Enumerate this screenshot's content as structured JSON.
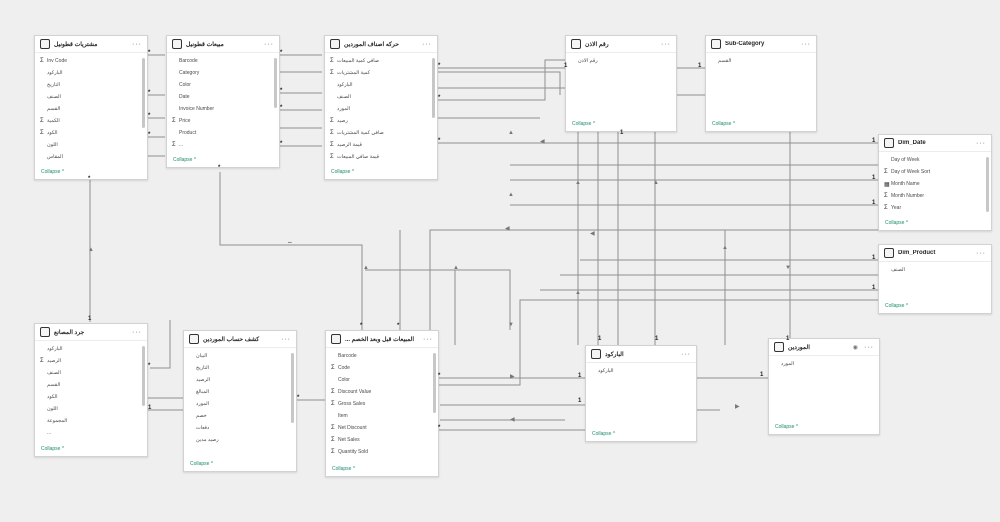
{
  "tables": [
    {
      "id": "purchases_cotton",
      "title": "مشتريات قطونيل",
      "collapse": "Collapse",
      "fields": [
        {
          "s": "Σ",
          "t": "Inv Code"
        },
        {
          "s": "",
          "t": "الباركود"
        },
        {
          "s": "",
          "t": "التاريخ"
        },
        {
          "s": "",
          "t": "الصنف"
        },
        {
          "s": "",
          "t": "القسم"
        },
        {
          "s": "Σ",
          "t": "الكمية"
        },
        {
          "s": "Σ",
          "t": "الكود"
        },
        {
          "s": "",
          "t": "اللون"
        },
        {
          "s": "",
          "t": "المقاس"
        }
      ]
    },
    {
      "id": "sales_cotton",
      "title": "مبيعات قطونيل",
      "collapse": "Collapse",
      "fields": [
        {
          "s": "",
          "t": "Barcode"
        },
        {
          "s": "",
          "t": "Category"
        },
        {
          "s": "",
          "t": "Color"
        },
        {
          "s": "",
          "t": "Date"
        },
        {
          "s": "",
          "t": "Invoice Number"
        },
        {
          "s": "Σ",
          "t": "Price"
        },
        {
          "s": "",
          "t": "Product"
        },
        {
          "s": "Σ",
          "t": "..."
        }
      ]
    },
    {
      "id": "supplier_items",
      "title": "حركه اصناف الموردين",
      "collapse": "Collapse",
      "fields": [
        {
          "s": "Σ",
          "t": "صافي كمية المبيعات"
        },
        {
          "s": "Σ",
          "t": "كمية المشتريات"
        },
        {
          "s": "",
          "t": "الباركود"
        },
        {
          "s": "",
          "t": "الصنف"
        },
        {
          "s": "",
          "t": "المورد"
        },
        {
          "s": "Σ",
          "t": "رصيد"
        },
        {
          "s": "Σ",
          "t": "صافي كمية المشتريات"
        },
        {
          "s": "Σ",
          "t": "قيمة الرصيد"
        },
        {
          "s": "Σ",
          "t": "قيمة صافي المبيعات"
        }
      ]
    },
    {
      "id": "permit_number",
      "title": "رقم الاذن",
      "collapse": "Collapse",
      "fields": [
        {
          "s": "",
          "t": "رقم الاذن"
        }
      ]
    },
    {
      "id": "sub_category",
      "title": "Sub-Category",
      "collapse": "Collapse",
      "fields": [
        {
          "s": "",
          "t": "القسم"
        }
      ]
    },
    {
      "id": "dim_date",
      "title": "Dim_Date",
      "collapse": "Collapse",
      "fields": [
        {
          "s": "",
          "t": "Day of Week"
        },
        {
          "s": "Σ",
          "t": "Day of Week Sort"
        },
        {
          "s": "▦",
          "t": "Month Name"
        },
        {
          "s": "Σ",
          "t": "Month Number"
        },
        {
          "s": "Σ",
          "t": "Year"
        }
      ]
    },
    {
      "id": "dim_product",
      "title": "Dim_Product",
      "collapse": "Collapse",
      "fields": [
        {
          "s": "",
          "t": "الصنف"
        }
      ]
    },
    {
      "id": "stock_count",
      "title": "جرد المصانع",
      "collapse": "Collapse",
      "fields": [
        {
          "s": "",
          "t": "الباركود"
        },
        {
          "s": "Σ",
          "t": "الرصيد"
        },
        {
          "s": "",
          "t": "الصنف"
        },
        {
          "s": "",
          "t": "القسم"
        },
        {
          "s": "",
          "t": "الكود"
        },
        {
          "s": "",
          "t": "اللون"
        },
        {
          "s": "",
          "t": "المجموعة"
        },
        {
          "s": "",
          "t": "..."
        }
      ]
    },
    {
      "id": "supplier_statement",
      "title": "كشف حساب الموردين",
      "collapse": "Collapse",
      "fields": [
        {
          "s": "",
          "t": "البيان"
        },
        {
          "s": "",
          "t": "التاريخ"
        },
        {
          "s": "",
          "t": "الرصيد"
        },
        {
          "s": "",
          "t": "المبالغ"
        },
        {
          "s": "",
          "t": "المورد"
        },
        {
          "s": "",
          "t": "خصم"
        },
        {
          "s": "",
          "t": "دفعات"
        },
        {
          "s": "",
          "t": "رصيد مدين"
        }
      ]
    },
    {
      "id": "sales_before_discount",
      "title": "... المبيعات قبل وبعد الخصم",
      "collapse": "Collapse",
      "fields": [
        {
          "s": "",
          "t": "Barcode"
        },
        {
          "s": "Σ",
          "t": "Code"
        },
        {
          "s": "",
          "t": "Color"
        },
        {
          "s": "Σ",
          "t": "Discount Value"
        },
        {
          "s": "Σ",
          "t": "Gross Sales"
        },
        {
          "s": "",
          "t": "Item"
        },
        {
          "s": "Σ",
          "t": "Net Discount"
        },
        {
          "s": "Σ",
          "t": "Net Sales"
        },
        {
          "s": "Σ",
          "t": "Quantity Sold"
        }
      ]
    },
    {
      "id": "barcode",
      "title": "الباركود",
      "collapse": "Collapse",
      "fields": [
        {
          "s": "",
          "t": "الباركود"
        }
      ]
    },
    {
      "id": "suppliers",
      "title": "الموردين",
      "collapse": "Collapse",
      "fields": [
        {
          "s": "",
          "t": "المورد"
        }
      ]
    }
  ],
  "icons": {
    "table": "table-icon",
    "more": "more-options-icon",
    "eye": "hidden-eye-icon"
  },
  "markers": {
    "many": "*",
    "one": "1",
    "both": "⇔"
  }
}
